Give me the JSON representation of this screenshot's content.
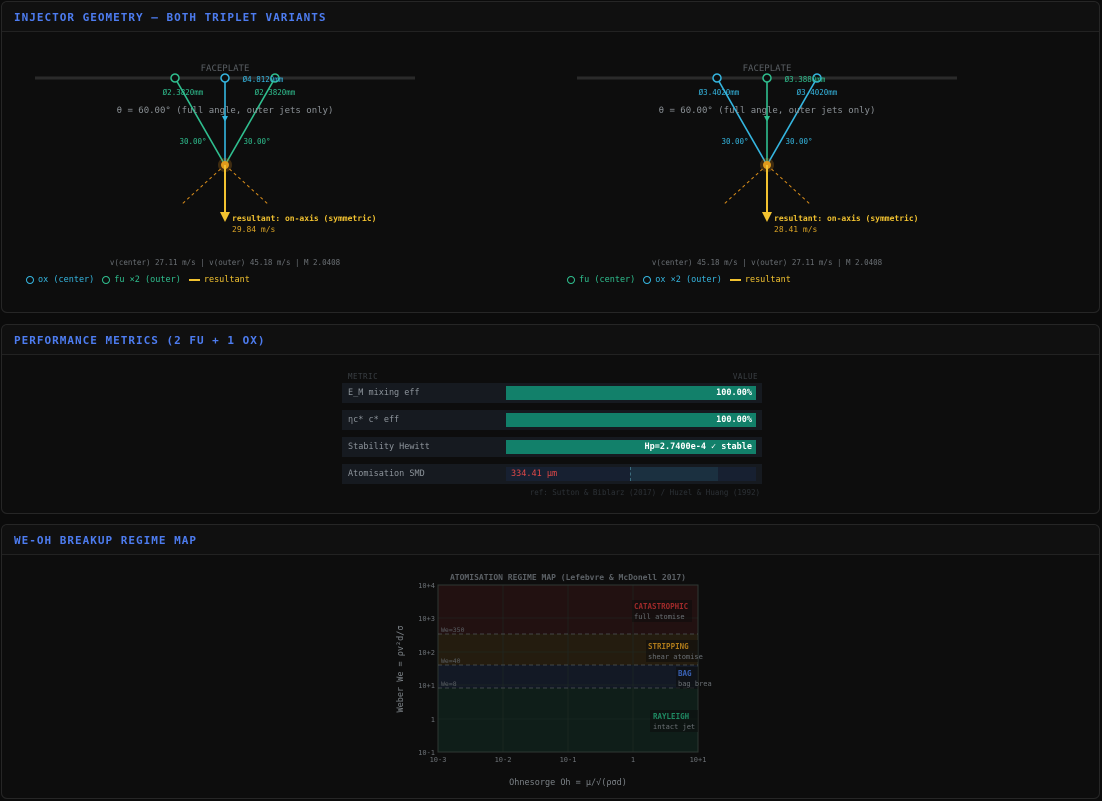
{
  "geometry_panel": {
    "title": "INJECTOR GEOMETRY — BOTH TRIPLET VARIANTS",
    "left": {
      "faceplate": "FACEPLATE",
      "d_left": "Ø2.3820mm",
      "d_center": "Ø4.8120mm",
      "d_right": "Ø2.3820mm",
      "theta": "θ = 60.00° (full angle, outer jets only)",
      "angle_left": "30.00°",
      "angle_right": "30.00°",
      "resultant_label": "resultant: on-axis (symmetric)",
      "resultant_speed": "29.84 m/s",
      "footer": "v(center) 27.11 m/s | v(outer) 45.18 m/s | M 2.0408",
      "legend": [
        "ox (center)",
        "fu ×2 (outer)",
        "resultant"
      ]
    },
    "right": {
      "faceplate": "FACEPLATE",
      "d_left": "Ø3.4020mm",
      "d_center": "Ø3.3880mm",
      "d_right": "Ø3.4020mm",
      "theta": "θ = 60.00° (full angle, outer jets only)",
      "angle_left": "30.00°",
      "angle_right": "30.00°",
      "resultant_label": "resultant: on-axis (symmetric)",
      "resultant_speed": "28.41 m/s",
      "footer": "v(center) 45.18 m/s | v(outer) 27.11 m/s | M 2.0408",
      "legend": [
        "fu (center)",
        "ox ×2 (outer)",
        "resultant"
      ]
    },
    "colors": {
      "fuel": "#2fbf8f",
      "ox": "#35b6e0",
      "resultant": "#f2c230",
      "impingement": "#d98d1a"
    }
  },
  "metrics_panel": {
    "title": "PERFORMANCE METRICS (2 FU + 1 OX)",
    "header_metric": "METRIC",
    "header_value": "VALUE",
    "rows": [
      {
        "label": "E_M  mixing eff",
        "value": "100.00%",
        "fill": 1.0
      },
      {
        "label": "ηc*  c* eff",
        "value": "100.00%",
        "fill": 1.0
      },
      {
        "label": "Stability  Hewitt",
        "value": "Hp=2.7400e-4  ✓ stable",
        "fill": 1.0
      },
      {
        "label": "Atomisation  SMD",
        "value": "334.41 μm"
      }
    ],
    "ref": "ref: Sutton & Biblarz (2017) / Huzel & Huang (1992)"
  },
  "regime_panel": {
    "title": "WE-OH BREAKUP REGIME MAP",
    "chart_title": "ATOMISATION REGIME MAP  (Lefebvre & McDonell 2017)",
    "x_label": "Ohnesorge  Oh = μ/√(ρσd)",
    "y_label": "Weber  We = ρv²d/σ",
    "x_ticks": [
      "10-3",
      "10-2",
      "10-1",
      "1",
      "10+1"
    ],
    "y_ticks": [
      "10+4",
      "10+3",
      "10+2",
      "10+1",
      "1",
      "10-1"
    ],
    "thresholds": [
      "We=350",
      "We=40",
      "We=8"
    ],
    "regions": [
      {
        "name": "CATASTROPHIC",
        "desc": "full atomise",
        "color": "#a02a2a"
      },
      {
        "name": "STRIPPING",
        "desc": "shear atomise",
        "color": "#b07b1a"
      },
      {
        "name": "BAG",
        "desc": "bag brea",
        "color": "#3a63b8"
      },
      {
        "name": "RAYLEIGH",
        "desc": "intact jet",
        "color": "#1f8a63"
      }
    ]
  }
}
